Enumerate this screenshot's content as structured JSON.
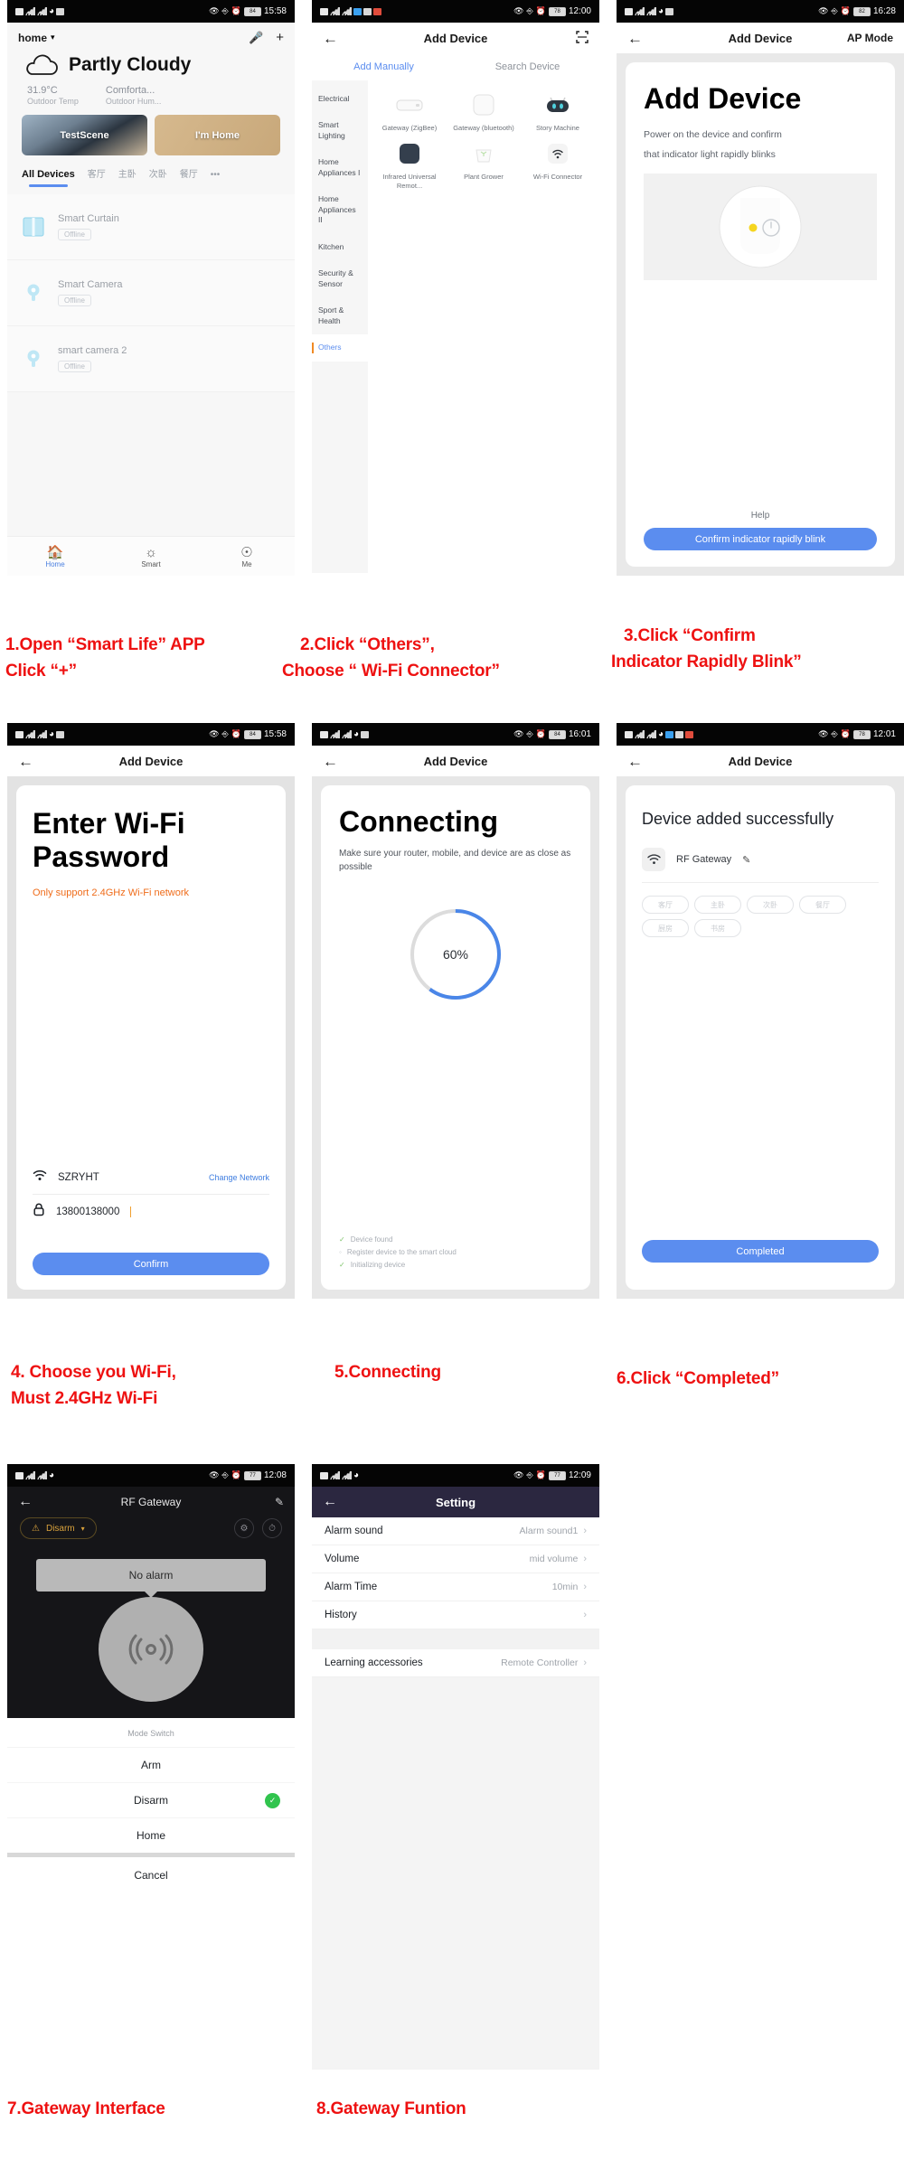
{
  "panels": {
    "p1": {
      "status": {
        "time": "15:58",
        "battery": "84"
      },
      "home_name": "home",
      "mic_icon": "microphone-icon",
      "add_icon": "plus-icon",
      "weather": {
        "icon": "cloud-icon",
        "title": "Partly Cloudy",
        "stats": [
          {
            "value": "31.9°C",
            "label": "Outdoor Temp"
          },
          {
            "value": "Comforta...",
            "label": "Outdoor Hum..."
          }
        ]
      },
      "scenes": [
        {
          "label": "TestScene"
        },
        {
          "label": "I'm Home"
        }
      ],
      "tabs": [
        "All Devices",
        "客厅",
        "主卧",
        "次卧",
        "餐厅",
        "•••"
      ],
      "devices": [
        {
          "name": "Smart Curtain",
          "status": "Offline",
          "icon": "curtain-icon"
        },
        {
          "name": "Smart  Camera",
          "status": "Offline",
          "icon": "camera-icon"
        },
        {
          "name": "smart camera 2",
          "status": "Offline",
          "icon": "camera-icon"
        }
      ],
      "tabbar": [
        {
          "label": "Home",
          "icon": "home-icon"
        },
        {
          "label": "Smart",
          "icon": "sun-icon"
        },
        {
          "label": "Me",
          "icon": "person-icon"
        }
      ]
    },
    "p2": {
      "status": {
        "time": "12:00",
        "battery": "78"
      },
      "title": "Add Device",
      "scan_icon": "scan-icon",
      "segments": [
        "Add Manually",
        "Search Device"
      ],
      "categories": [
        "Electrical",
        "Smart Lighting",
        "Home Appliances I",
        "Home Appliances II",
        "Kitchen",
        "Security & Sensor",
        "Sport & Health",
        "Others"
      ],
      "devices": [
        {
          "label": "Gateway (ZigBee)",
          "icon": "gateway-zigbee-icon"
        },
        {
          "label": "Gateway (bluetooth)",
          "icon": "gateway-bluetooth-icon"
        },
        {
          "label": "Story Machine",
          "icon": "story-machine-icon"
        },
        {
          "label": "Infrared Universal Remot...",
          "icon": "infrared-remote-icon"
        },
        {
          "label": "Plant Grower",
          "icon": "plant-grower-icon"
        },
        {
          "label": "Wi-Fi Connector",
          "icon": "wifi-connector-icon"
        }
      ]
    },
    "p3": {
      "status": {
        "time": "16:28",
        "battery": "82"
      },
      "title": "Add Device",
      "mode": "AP Mode",
      "heading": "Add Device",
      "line1": "Power on the device and confirm",
      "line2": "that indicator light rapidly blinks",
      "illustration_icon": "power-indicator-icon",
      "help": "Help",
      "confirm": "Confirm indicator rapidly blink"
    },
    "p4": {
      "status": {
        "time": "15:58",
        "battery": "84"
      },
      "title": "Add Device",
      "heading": "Enter Wi-Fi Password",
      "warning": "Only support 2.4GHz Wi-Fi network",
      "ssid": "SZRYHT",
      "ssid_icon": "wifi-icon",
      "change_network": "Change Network",
      "password": "13800138000",
      "password_icon": "lock-icon",
      "confirm": "Confirm"
    },
    "p5": {
      "status": {
        "time": "16:01",
        "battery": "84"
      },
      "title": "Add Device",
      "heading": "Connecting",
      "subtitle": "Make sure your router, mobile, and device are as close as possible",
      "percent": "60%",
      "percent_value": 60,
      "steps": [
        {
          "label": "Device found",
          "state": "done"
        },
        {
          "label": "Register device to the smart cloud",
          "state": "pending"
        },
        {
          "label": "Initializing device",
          "state": "done"
        }
      ]
    },
    "p6": {
      "status": {
        "time": "12:01",
        "battery": "78"
      },
      "title": "Add Device",
      "heading": "Device added successfully",
      "device_name": "RF Gateway",
      "device_icon": "wifi-icon",
      "edit_icon": "pencil-icon",
      "rooms": [
        "客厅",
        "主卧",
        "次卧",
        "餐厅",
        "厨房",
        "书房"
      ],
      "completed": "Completed"
    },
    "p7": {
      "status": {
        "time": "12:08",
        "battery": "77"
      },
      "title": "RF Gateway",
      "edit_icon": "pencil-icon",
      "mode_pill": "Disarm",
      "warning_icon": "warning-icon",
      "gear_icon": "gear-icon",
      "clock_icon": "clock-icon",
      "alarm_text": "No alarm",
      "siren_icon": "siren-icon",
      "sheet_title": "Mode Switch",
      "options": [
        {
          "label": "Arm",
          "selected": false
        },
        {
          "label": "Disarm",
          "selected": true
        },
        {
          "label": "Home",
          "selected": false
        }
      ],
      "cancel": "Cancel"
    },
    "p8": {
      "status": {
        "time": "12:09",
        "battery": "77"
      },
      "title": "Setting",
      "rows": [
        {
          "label": "Alarm sound",
          "value": "Alarm sound1"
        },
        {
          "label": "Volume",
          "value": "mid volume"
        },
        {
          "label": "Alarm Time",
          "value": "10min"
        },
        {
          "label": "History",
          "value": ""
        }
      ],
      "rows2": [
        {
          "label": "Learning accessories",
          "value": "Remote Controller"
        }
      ]
    }
  },
  "captions": {
    "c1a": "1.Open “Smart Life” APP",
    "c1b": "Click “+”",
    "c2a": "2.Click “Others”,",
    "c2b": "Choose “ Wi-Fi Connector”",
    "c3a": "3.Click “Confirm",
    "c3b": "Indicator Rapidly Blink”",
    "c4a": "4. Choose you Wi-Fi,",
    "c4b": "Must 2.4GHz Wi-Fi",
    "c5": "5.Connecting",
    "c6": "6.Click “Completed”",
    "c7": "7.Gateway Interface",
    "c8": "8.Gateway Funtion"
  },
  "colors": {
    "accent_blue": "#5b8def",
    "caption_red": "#ee1111",
    "warning_orange": "#ef6c1a",
    "success_green": "#31c44e",
    "gateway_gold": "#d9a23c"
  }
}
